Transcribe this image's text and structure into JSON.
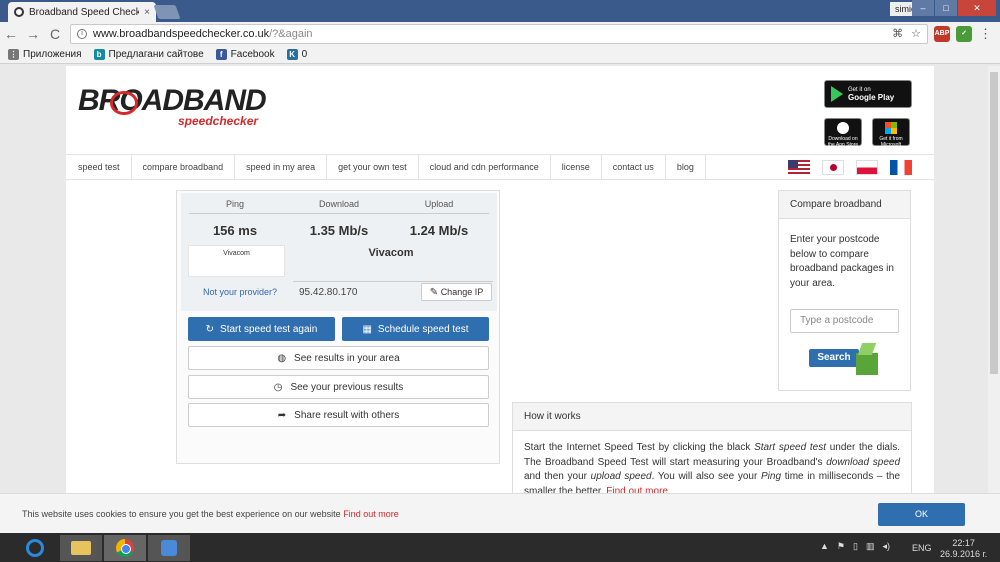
{
  "browser": {
    "tab_title": "Broadband Speed Check",
    "tab_close": "×",
    "user": "simion",
    "win_min": "–",
    "win_max": "□",
    "win_close": "✕",
    "back": "←",
    "forward": "→",
    "reload": "C",
    "url_host": "www.broadbandspeedchecker.co.uk",
    "url_path": "/?&again",
    "bookmarks": [
      {
        "label": "Приложения",
        "icon": "apps-icon"
      },
      {
        "label": "Предлагани сайтове",
        "icon": "bing-icon"
      },
      {
        "label": "Facebook",
        "icon": "facebook-icon"
      },
      {
        "label": "0",
        "icon": "k-icon"
      }
    ]
  },
  "site": {
    "logo_text": "BROADBAND",
    "logo_sub": "speedchecker",
    "google_play_small": "Get it on",
    "google_play": "Google Play",
    "app_store": "Download on the App Store",
    "microsoft": "Get it from Microsoft",
    "nav": [
      "speed test",
      "compare broadband",
      "speed in my area",
      "get your own test",
      "cloud and cdn performance",
      "license",
      "contact us",
      "blog"
    ]
  },
  "results": {
    "ping_label": "Ping",
    "download_label": "Download",
    "upload_label": "Upload",
    "ping": "156 ms",
    "download": "1.35 Mb/s",
    "upload": "1.24 Mb/s",
    "provider_logo_text": "Vivacom",
    "provider": "Vivacom",
    "not_provider": "Not your provider?",
    "ip": "95.42.80.170",
    "change_ip": "Change IP"
  },
  "actions": {
    "start": "Start speed test again",
    "schedule": "Schedule speed test",
    "see_results": "See results in your area",
    "previous": "See your previous results",
    "share": "Share result with others"
  },
  "compare": {
    "title": "Compare broadband",
    "text": "Enter your postcode below to compare broadband packages in your area.",
    "placeholder": "Type a postcode",
    "search": "Search"
  },
  "how": {
    "title": "How it works",
    "p1": "Start the Internet Speed Test by clicking the black ",
    "p1_em": "Start speed test",
    "p2": " under the dials. The Broadband Speed Test will start measuring your Broadband's ",
    "p2_em": "download speed",
    "p3": " and then your ",
    "p3_em": "upload speed",
    "p4": ". You will also see your ",
    "p4_em": "Ping",
    "p5": " time in milliseconds – the smaller the better. ",
    "find_out": "Find out more"
  },
  "cookie": {
    "text": "This website uses cookies to ensure you get the best experience on our website ",
    "link": "Find out more",
    "ok": "OK"
  },
  "taskbar": {
    "lang": "ENG",
    "time": "22:17",
    "date": "26.9.2016 г."
  }
}
